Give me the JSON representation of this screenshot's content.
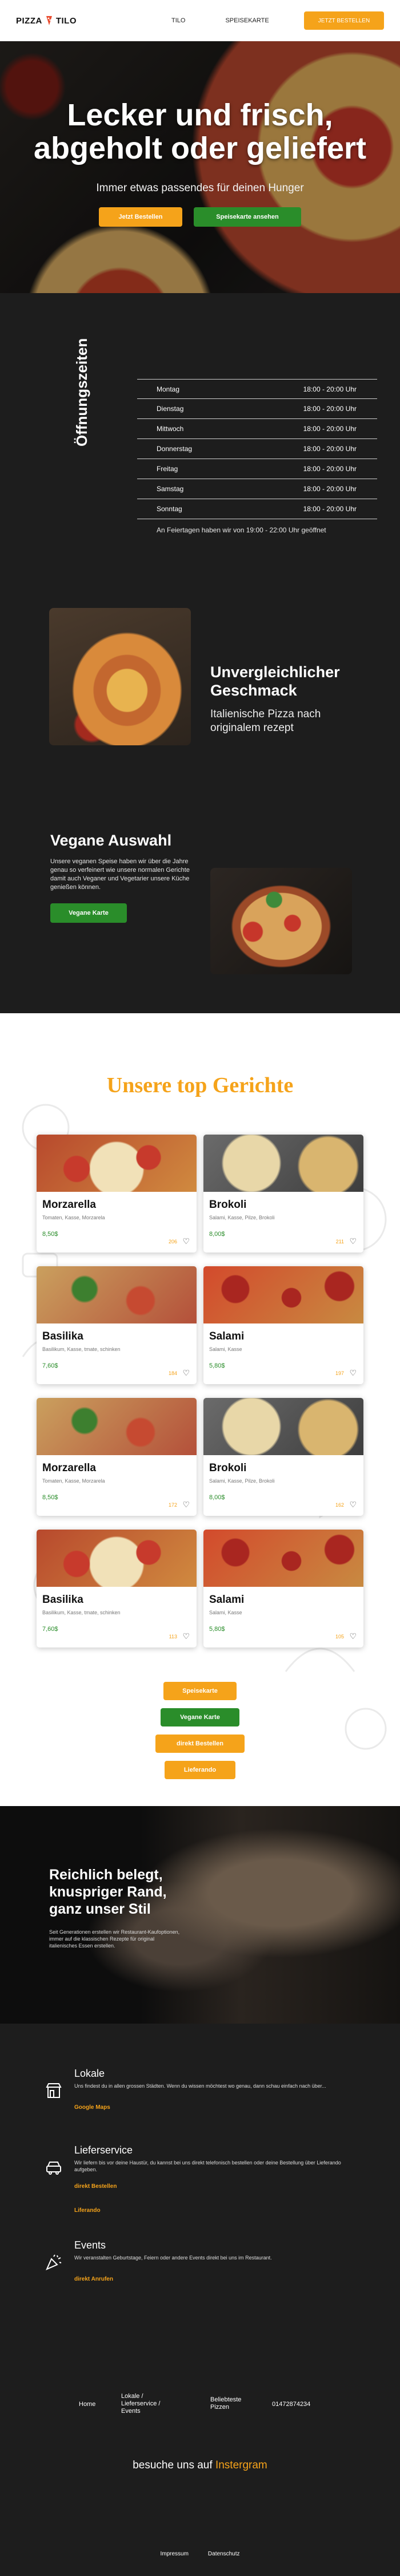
{
  "header": {
    "logo_left": "PIZZA",
    "logo_right": "TILO",
    "nav": [
      "TILO",
      "SPEISEKARTE"
    ],
    "cta": "JETZT BESTELLEN"
  },
  "hero": {
    "title": "Lecker und frisch, abgeholt oder geliefert",
    "subtitle": "Immer etwas passendes für deinen Hunger",
    "btn_order": "Jetzt Bestellen",
    "btn_menu": "Speisekarte ansehen"
  },
  "hours": {
    "title": "Öffnungszeiten",
    "rows": [
      {
        "day": "Montag",
        "time": "18:00 - 20:00 Uhr"
      },
      {
        "day": "Dienstag",
        "time": "18:00 - 20:00 Uhr"
      },
      {
        "day": "Mittwoch",
        "time": "18:00 - 20:00 Uhr"
      },
      {
        "day": "Donnerstag",
        "time": "18:00 - 20:00 Uhr"
      },
      {
        "day": "Freitag",
        "time": "18:00 - 20:00 Uhr"
      },
      {
        "day": "Samstag",
        "time": "18:00 - 20:00 Uhr"
      },
      {
        "day": "Sonntag",
        "time": "18:00 - 20:00 Uhr"
      }
    ],
    "note": "An Feiertagen haben wir von 19:00 - 22:00 Uhr geöffnet"
  },
  "feature1": {
    "title": "Unvergleichlicher Geschmack",
    "text": "Italienische Pizza nach originalem rezept"
  },
  "feature2": {
    "title": "Vegane Auswahl",
    "text": "Unsere veganen Speise haben wir über die Jahre genau so verfeinert wie unsere normalen Gerichte damit auch Veganer und Vegetarier unsere Küche genießen können.",
    "button": "Vegane Karte"
  },
  "dishes": {
    "title": "Unsere top Gerichte",
    "cards": [
      {
        "name": "Morzarella",
        "desc": "Tomaten, Kasse, Morzarela",
        "price": "8,50$",
        "likes": "206"
      },
      {
        "name": "Brokoli",
        "desc": "Salami, Kasse, Pilze, Brokoli",
        "price": "8,00$",
        "likes": "211"
      },
      {
        "name": "Basilika",
        "desc": "Basilikum, Kasse, tmate, schinken",
        "price": "7,60$",
        "likes": "184"
      },
      {
        "name": "Salami",
        "desc": "Salami, Kasse",
        "price": "5,80$",
        "likes": "197"
      },
      {
        "name": "Morzarella",
        "desc": "Tomaten, Kasse, Morzarela",
        "price": "8,50$",
        "likes": "172"
      },
      {
        "name": "Brokoli",
        "desc": "Salami, Kasse, Pilze, Brokoli",
        "price": "8,00$",
        "likes": "162"
      },
      {
        "name": "Basilika",
        "desc": "Basilikum, Kasse, tmate, schinken",
        "price": "7,60$",
        "likes": "113"
      },
      {
        "name": "Salami",
        "desc": "Salami, Kasse",
        "price": "5,80$",
        "likes": "105"
      }
    ],
    "buttons": [
      "Speisekarte",
      "Vegane Karte",
      "direkt Bestellen",
      "Lieferando"
    ]
  },
  "kitchen": {
    "title": "Reichlich belegt, knuspriger Rand, ganz unser Stil",
    "text": "Seit Generationen erstellen wir Restaurant-Kaufoptionen, immer auf die klassischen Rezepte für original italienisches Essen erstellen."
  },
  "services": {
    "lokale": {
      "title": "Lokale",
      "text": "Uns findest du in allen grossen Städten. Wenn du wissen möchtest wo genau, dann schau einfach nach über...",
      "link": "Google Maps"
    },
    "lieferservice": {
      "title": "Lieferservice",
      "text": "Wir liefern bis vor deine Haustür, du kannst bei uns direkt telefonisch bestellen oder deine Bestellung über Lieferando aufgeben.",
      "link1": "direkt Bestellen",
      "link2": "Liferando"
    },
    "events": {
      "title": "Events",
      "text": "Wir veranstalten Geburtstage, Feiern oder andere Events direkt bei uns im Restaurant.",
      "link": "direkt Anrufen"
    }
  },
  "footer": {
    "home": "Home",
    "lokale": "Lokale /\nLieferservice /\nEvents",
    "pizzen": "Beliebteste\nPizzen",
    "phone": "01472874234",
    "insta_prefix": "besuche uns auf",
    "insta_account": "Instergram",
    "impressum": "Impressum",
    "datenschutz": "Datenschutz"
  },
  "colors": {
    "accent": "#f5a31a",
    "green": "#2a8d2a",
    "dark": "#1d1d1d"
  }
}
